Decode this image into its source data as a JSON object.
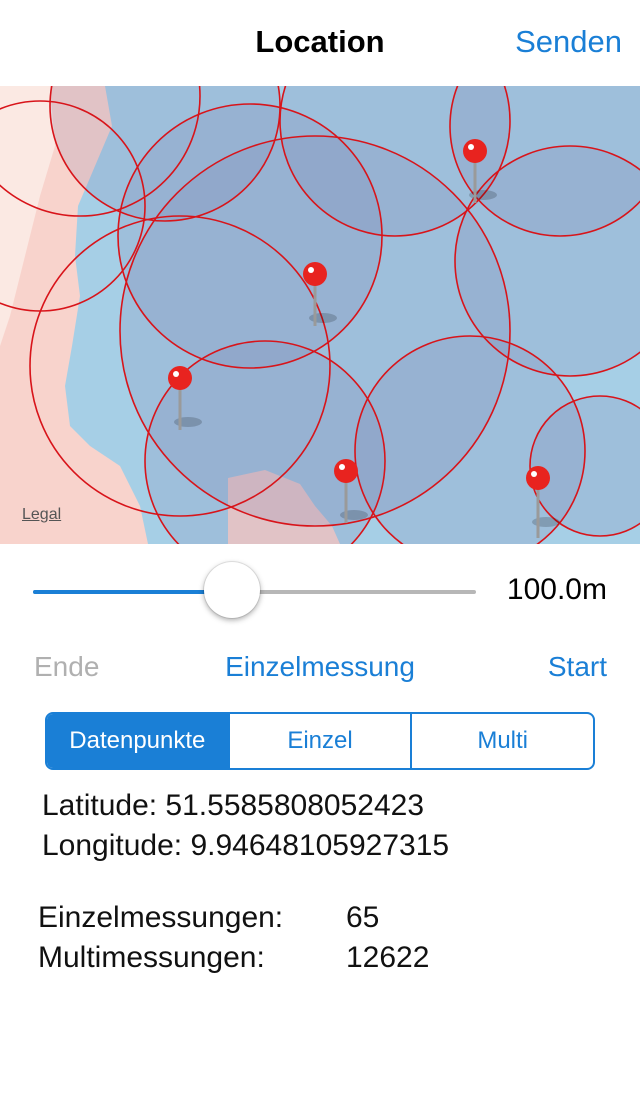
{
  "nav": {
    "title": "Location",
    "action_label": "Senden"
  },
  "map": {
    "legal_label": "Legal",
    "pin_color": "#e8231f",
    "circle_color": "#d8141a",
    "water_color": "#a6cfe6",
    "land_color": "#f8d3cc"
  },
  "slider": {
    "value_label": "100.0m",
    "fraction": 0.45
  },
  "actions": {
    "end_label": "Ende",
    "mode_label": "Einzelmessung",
    "start_label": "Start"
  },
  "segmented": {
    "items": [
      {
        "label": "Datenpunkte",
        "selected": true
      },
      {
        "label": "Einzel",
        "selected": false
      },
      {
        "label": "Multi",
        "selected": false
      }
    ]
  },
  "coords": {
    "latitude_label": "Latitude: 51.5585808052423",
    "longitude_label": "Longitude: 9.94648105927315"
  },
  "stats": {
    "einzel_label": "Einzelmessungen:",
    "einzel_value": "65",
    "multi_label": "Multimessungen:",
    "multi_value": "12622"
  },
  "colors": {
    "accent": "#1a7fd6",
    "disabled": "#b0b0b0"
  }
}
